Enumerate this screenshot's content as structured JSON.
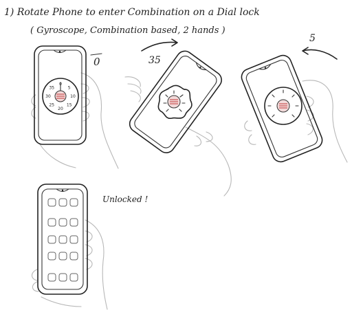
{
  "title_line1": "1) Rotate Phone to enter Combination on a Dial lock",
  "title_line2": "( Gyroscope, Combination based, 2 hands )",
  "phones": [
    {
      "label": "0",
      "dial_numbers": [
        "0",
        "5",
        "10",
        "15",
        "20",
        "25",
        "30",
        "35"
      ]
    },
    {
      "label": "35"
    },
    {
      "label": "5"
    }
  ],
  "unlocked_label": "Unlocked !"
}
